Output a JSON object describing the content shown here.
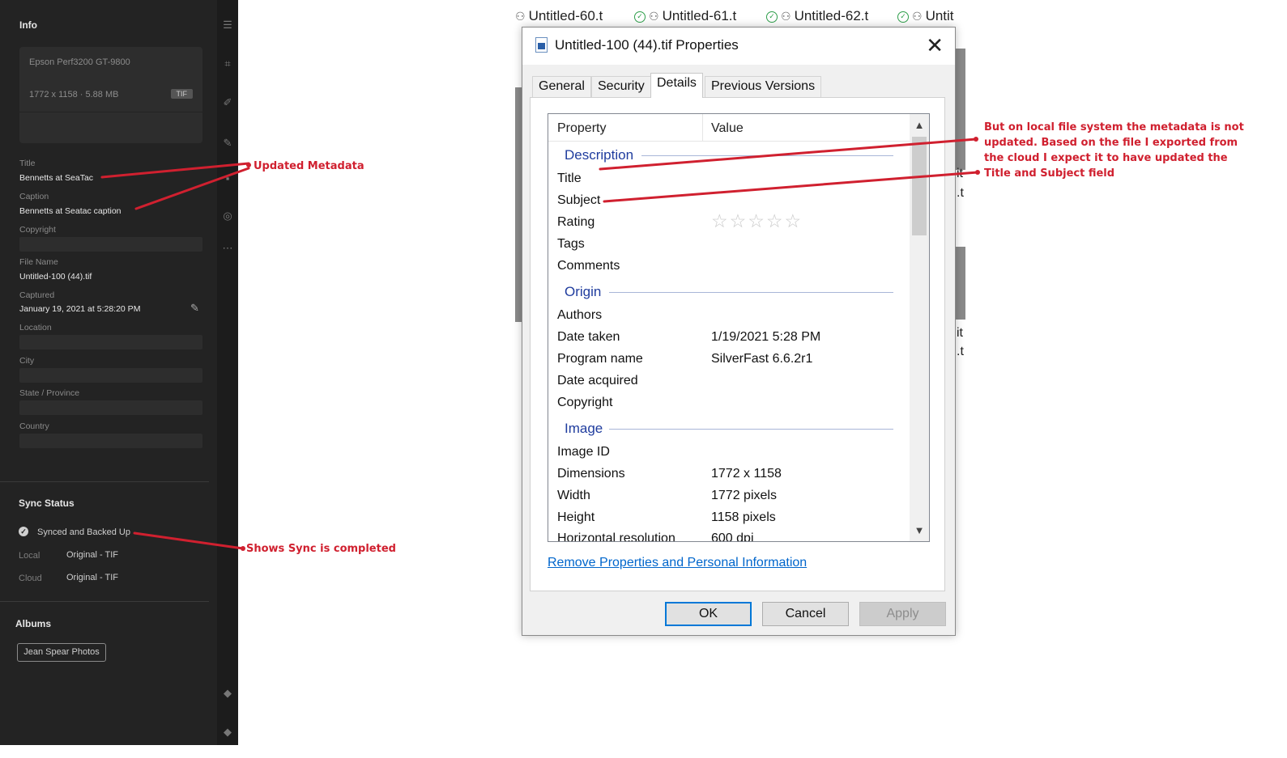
{
  "lightroom": {
    "panel_title": "Info",
    "camera": "Epson Perf3200 GT-9800",
    "dimensions_size": "1772 x 1158  ·  5.88 MB",
    "format_badge": "TIF",
    "fields": {
      "title_label": "Title",
      "title_value": "Bennetts at SeaTac",
      "caption_label": "Caption",
      "caption_value": "Bennetts at Seatac caption",
      "copyright_label": "Copyright",
      "filename_label": "File Name",
      "filename_value": "Untitled-100 (44).tif",
      "captured_label": "Captured",
      "captured_value": "January 19, 2021 at 5:28:20 PM",
      "location_label": "Location",
      "city_label": "City",
      "state_label": "State / Province",
      "country_label": "Country"
    },
    "sync": {
      "heading": "Sync Status",
      "status": "Synced and Backed Up",
      "local_label": "Local",
      "local_value": "Original - TIF",
      "cloud_label": "Cloud",
      "cloud_value": "Original - TIF"
    },
    "albums": {
      "heading": "Albums",
      "album_name": "Jean Spear Photos"
    }
  },
  "explorer": {
    "files": [
      "Untitled-60.t",
      "Untitled-61.t",
      "Untitled-62.t",
      "Untit"
    ],
    "partial_right": [
      "it",
      ".t",
      "it",
      ".t"
    ]
  },
  "dialog": {
    "title": "Untitled-100 (44).tif Properties",
    "close": "✕",
    "tabs": [
      "General",
      "Security",
      "Details",
      "Previous Versions"
    ],
    "active_tab": "Details",
    "header": {
      "property": "Property",
      "value": "Value"
    },
    "groups": {
      "description": "Description",
      "origin": "Origin",
      "image": "Image"
    },
    "rows": [
      {
        "name": "Title",
        "value": ""
      },
      {
        "name": "Subject",
        "value": ""
      },
      {
        "name": "Rating",
        "value": ""
      },
      {
        "name": "Tags",
        "value": ""
      },
      {
        "name": "Comments",
        "value": ""
      },
      {
        "name": "Authors",
        "value": ""
      },
      {
        "name": "Date taken",
        "value": "1/19/2021 5:28 PM"
      },
      {
        "name": "Program name",
        "value": "SilverFast 6.6.2r1"
      },
      {
        "name": "Date acquired",
        "value": ""
      },
      {
        "name": "Copyright",
        "value": ""
      },
      {
        "name": "Image ID",
        "value": ""
      },
      {
        "name": "Dimensions",
        "value": "1772 x 1158"
      },
      {
        "name": "Width",
        "value": "1772 pixels"
      },
      {
        "name": "Height",
        "value": "1158 pixels"
      },
      {
        "name": "Horizontal resolution",
        "value": "600 dpi"
      }
    ],
    "rating_stars": "☆☆☆☆☆",
    "remove_link": "Remove Properties and Personal Information",
    "buttons": {
      "ok": "OK",
      "cancel": "Cancel",
      "apply": "Apply"
    }
  },
  "annotations": {
    "updated_metadata": "Updated Metadata",
    "sync_completed": "Shows Sync is completed",
    "local_note": "But on local file system the metadata is not updated.  Based on the file I exported from the cloud I expect it to have updated the Title and Subject field",
    "color": "#d0202f"
  }
}
